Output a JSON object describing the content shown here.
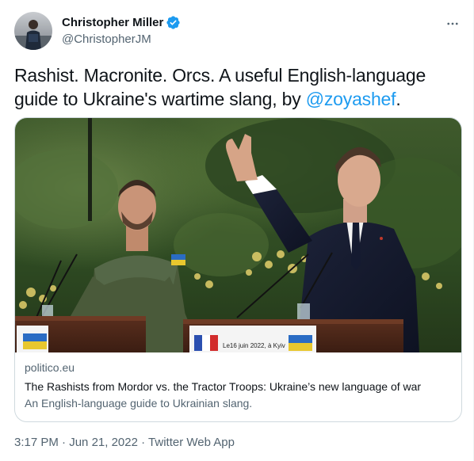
{
  "author": {
    "display_name": "Christopher Miller",
    "handle": "@ChristopherJM",
    "verified": true
  },
  "tweet": {
    "text_before": "Rashist. Macronite. Orcs. A useful English-language guide to Ukraine's wartime slang, by ",
    "mention": "@zoyashef",
    "text_after": "."
  },
  "card": {
    "domain": "politico.eu",
    "title": "The Rashists from Mordor vs. the Tractor Troops: Ukraine’s new language of war",
    "description": "An English-language guide to Ukrainian slang.",
    "image_caption": "Le16 juin 2022, à Kyiv"
  },
  "meta": {
    "time": "3:17 PM",
    "separator": " · ",
    "date": "Jun 21, 2022",
    "source": "Twitter Web App"
  },
  "colors": {
    "accent": "#1d9bf0",
    "text_primary": "#0f1419",
    "text_secondary": "#536471",
    "border": "#cfd9de"
  },
  "icons": {
    "verified": "verified-badge-icon",
    "more": "more-dots-icon"
  }
}
